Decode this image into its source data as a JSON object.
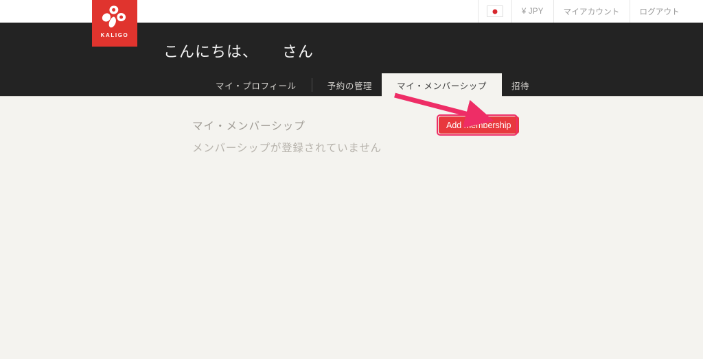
{
  "topbar": {
    "flag_icon": "japan-flag-icon",
    "currency": "¥ JPY",
    "account_link": "マイアカウント",
    "logout_link": "ログアウト"
  },
  "branding": {
    "logo_icon": "kaligo-pinwheel-icon",
    "logo_text": "KALIGO",
    "logo_color": "#e0342e"
  },
  "header": {
    "greeting": "こんにちは、　　さん",
    "background": "#232323",
    "tabs": [
      {
        "label": "マイ・プロフィール",
        "active": false
      },
      {
        "label": "予約の管理",
        "active": false
      },
      {
        "label": "マイ・メンバーシップ",
        "active": true
      },
      {
        "label": "招待",
        "active": false
      }
    ]
  },
  "main": {
    "section_title": "マイ・メンバーシップ",
    "empty_message": "メンバーシップが登録されていません",
    "add_membership_label": "Add membership",
    "add_membership_color": "#e8383e",
    "background": "#f4f3ef"
  },
  "annotation": {
    "arrow_color": "#ee2d66",
    "highlight_color": "#ee2d66"
  }
}
